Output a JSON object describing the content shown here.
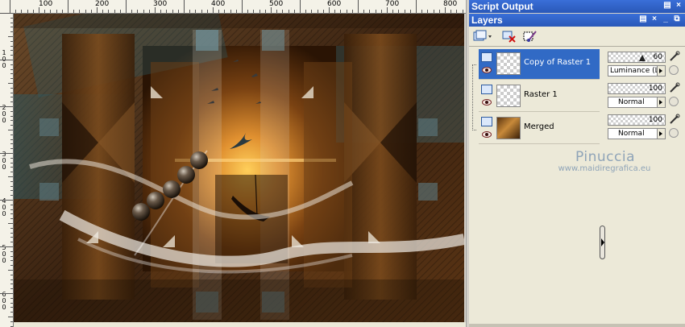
{
  "canvas": {
    "ruler_top_labels": [
      "100",
      "200",
      "300",
      "400",
      "500",
      "600",
      "700",
      "800"
    ],
    "ruler_left_labels": [
      "100",
      "200",
      "300",
      "400",
      "500",
      "600"
    ]
  },
  "script_output": {
    "title": "Script Output"
  },
  "layers_palette": {
    "title": "Layers",
    "window_controls": [
      "pin-icon",
      "close-icon",
      "minimize-icon",
      "restore-icon",
      "close-icon"
    ],
    "layers": [
      {
        "name": "Copy of Raster 1",
        "selected": true,
        "opacity": "60",
        "blend": "Luminance (L)"
      },
      {
        "name": "Raster 1",
        "selected": false,
        "opacity": "100",
        "blend": "Normal"
      },
      {
        "name": "Merged",
        "selected": false,
        "opacity": "100",
        "blend": "Normal"
      }
    ]
  },
  "watermark": {
    "name": "Pinuccia",
    "url": "www.maidiregrafica.eu"
  },
  "colors": {
    "titlebar": "#2a58b8",
    "selected_row": "#316ac5",
    "panel_bg": "#ece9d8"
  }
}
